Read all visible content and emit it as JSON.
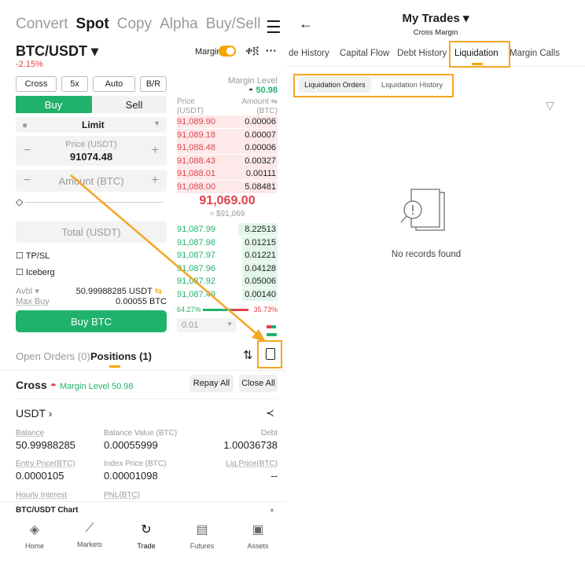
{
  "left": {
    "top_tabs": [
      "Convert",
      "Spot",
      "Copy",
      "Alpha",
      "Buy/Sell"
    ],
    "active_tab": "Spot",
    "pair": "BTC/USDT",
    "change": "-2.15%",
    "margin_label": "Margin",
    "chips": [
      "Cross",
      "5x",
      "Auto",
      "B/R"
    ],
    "buy_label": "Buy",
    "sell_label": "Sell",
    "order_type": "Limit",
    "price_label": "Price (USDT)",
    "price_value": "91074.48",
    "amount_placeholder": "Amount (BTC)",
    "total_placeholder": "Total (USDT)",
    "tpsl": "TP/SL",
    "iceberg": "Iceberg",
    "avbl_label": "Avbl",
    "avbl_value": "50.99988285 USDT",
    "maxbuy_label": "Max Buy",
    "maxbuy_value": "0.00055 BTC",
    "buy_btc": "Buy BTC",
    "orderbook": {
      "margin_level_label": "Margin Level",
      "margin_level_value": "50.98",
      "price_hdr": "Price",
      "price_unit": "(USDT)",
      "amount_hdr": "Amount",
      "amount_unit": "(BTC)",
      "asks": [
        [
          "91,089.90",
          "0.00006"
        ],
        [
          "91,089.18",
          "0.00007"
        ],
        [
          "91,088.48",
          "0.00006"
        ],
        [
          "91,088.43",
          "0.00327"
        ],
        [
          "91,088.01",
          "0.00111"
        ],
        [
          "91,088.00",
          "5.08481"
        ]
      ],
      "last_price": "91,069.00",
      "last_usd": "≈ $91,069",
      "bids": [
        [
          "91,087.99",
          "8.22513"
        ],
        [
          "91,087.98",
          "0.01215"
        ],
        [
          "91,087.97",
          "0.01221"
        ],
        [
          "91,087.96",
          "0.04128"
        ],
        [
          "91,087.92",
          "0.05006"
        ],
        [
          "91,087.49",
          "0.00140"
        ]
      ],
      "buy_pct": "64.27%",
      "sell_pct": "35.73%",
      "buy_ratio": 0.6427,
      "step": "0.01"
    },
    "open_orders": "Open Orders (0)",
    "positions": "Positions (1)",
    "cross_label": "Cross",
    "cross_margin_level": "Margin Level 50.98",
    "repay_all": "Repay All",
    "close_all": "Close All",
    "asset": "USDT",
    "balance_label": "Balance",
    "balance_value": "50.99988285",
    "balance_btc_label": "Balance Value (BTC)",
    "balance_btc_value": "0.00055999",
    "debt_label": "Debt",
    "debt_value": "1.00036738",
    "entry_label": "Entry Price(BTC)",
    "entry_value": "0.0000105",
    "index_label": "Index Price (BTC)",
    "index_value": "0.00001098",
    "liq_label": "Liq.Price(BTC)",
    "liq_value": "--",
    "hourly_label": "Hourly Interest",
    "pnl_label": "PNL(BTC)",
    "chart_label": "BTC/USDT Chart",
    "footer": [
      "Home",
      "Markets",
      "Trade",
      "Futures",
      "Assets"
    ]
  },
  "right": {
    "title": "My Trades",
    "subtitle": "Cross Margin",
    "tabs": [
      "de History",
      "Capital Flow",
      "Debt History",
      "Liquidation",
      "Margin Calls"
    ],
    "active_tab": "Liquidation",
    "subtabs": [
      "Liquidation Orders",
      "Liquidation History"
    ],
    "empty_text": "No records found"
  },
  "colors": {
    "green": "#20b26c",
    "red": "#e0424a",
    "accent": "#f7a600",
    "highlight": "#f5a623"
  }
}
